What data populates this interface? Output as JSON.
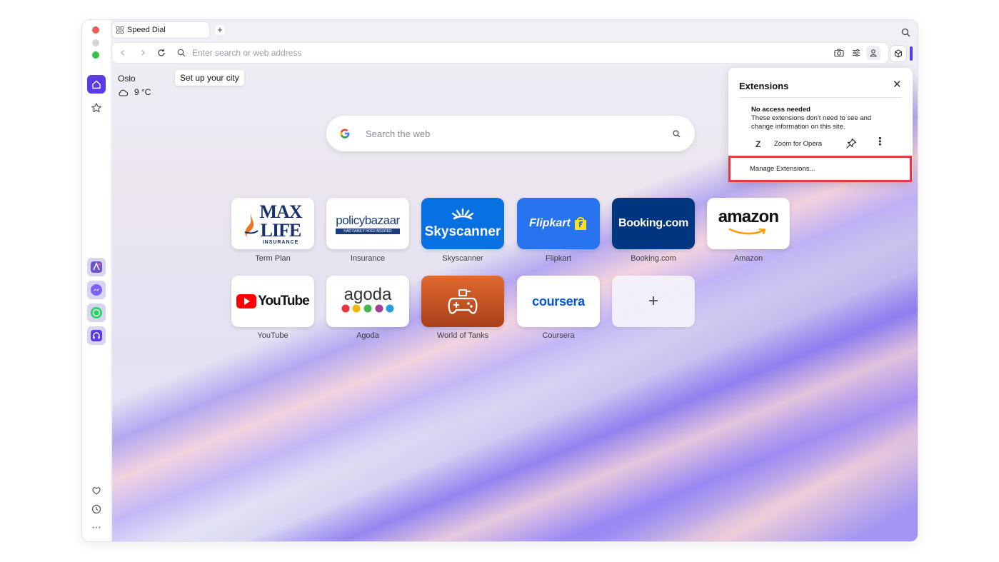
{
  "tab": {
    "title": "Speed Dial"
  },
  "address_bar": {
    "placeholder": "Enter search or web address"
  },
  "weather": {
    "city": "Oslo",
    "setup_tooltip": "Set up your city",
    "temperature": "9 °C"
  },
  "search": {
    "placeholder": "Search the web"
  },
  "speed_dial": [
    {
      "name": "Term Plan",
      "logo": "MAX LIFE INSURANCE"
    },
    {
      "name": "Insurance",
      "logo": "policybazaar"
    },
    {
      "name": "Skyscanner",
      "logo": "Skyscanner"
    },
    {
      "name": "Flipkart",
      "logo": "Flipkart"
    },
    {
      "name": "Booking.com",
      "logo": "Booking.com"
    },
    {
      "name": "Amazon",
      "logo": "amazon"
    },
    {
      "name": "YouTube",
      "logo": "YouTube"
    },
    {
      "name": "Agoda",
      "logo": "agoda"
    },
    {
      "name": "World of Tanks",
      "logo": ""
    },
    {
      "name": "Coursera",
      "logo": "coursera"
    },
    {
      "name": "",
      "logo": "+"
    }
  ],
  "extensions_popup": {
    "title": "Extensions",
    "section_title": "No access needed",
    "section_desc": "These extensions don't need to see and change information on this site.",
    "extension_name": "Zoom for Opera",
    "extension_icon_letter": "Z",
    "manage_label": "Manage Extensions..."
  },
  "colors": {
    "accent": "#5b3be6",
    "highlight": "#e53945"
  }
}
